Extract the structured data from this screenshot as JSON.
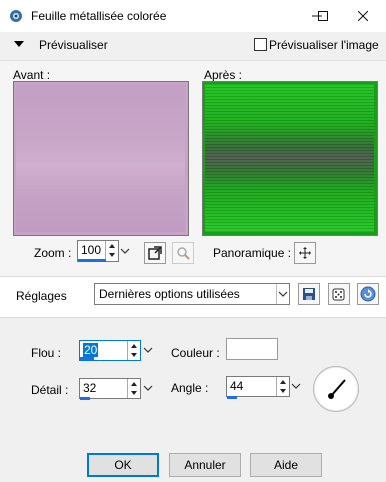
{
  "window": {
    "title": "Feuille métallisée colorée"
  },
  "preview": {
    "toggle_label": "Prévisualiser",
    "checkbox_label": "Prévisualiser l'image",
    "checked": false,
    "before_label": "Avant :",
    "after_label": "Après :"
  },
  "zoom": {
    "label": "Zoom :",
    "value": "100",
    "pan_label": "Panoramique :"
  },
  "presets": {
    "label": "Réglages",
    "selected": "Dernières options utilisées"
  },
  "params": {
    "flou_label": "Flou :",
    "flou_value": "20",
    "couleur_label": "Couleur :",
    "couleur_value": "#ffffff",
    "detail_label": "Détail :",
    "detail_value": "32",
    "angle_label": "Angle :",
    "angle_value": "44"
  },
  "buttons": {
    "ok": "OK",
    "cancel": "Annuler",
    "help": "Aide"
  },
  "colors": {
    "accent": "#1e6ee8",
    "before_preview": "#c7a4c7",
    "after_preview": "#1fb51f"
  }
}
